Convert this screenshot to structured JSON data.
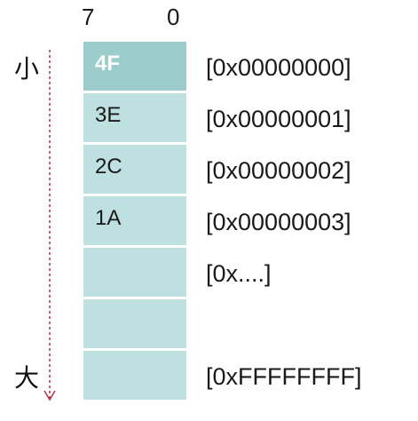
{
  "bits": {
    "high": "7",
    "low": "0"
  },
  "direction": {
    "small": "小",
    "large": "大"
  },
  "colors": {
    "cell": "#bfe0e0",
    "cell_highlight": "#9ccccc",
    "arrow": "#b03040"
  },
  "cells": [
    {
      "value": "4F",
      "address": "[0x00000000]",
      "highlight": true
    },
    {
      "value": "3E",
      "address": "[0x00000001]"
    },
    {
      "value": "2C",
      "address": "[0x00000002]"
    },
    {
      "value": "1A",
      "address": "[0x00000003]"
    },
    {
      "value": "",
      "address": "[0x....]"
    },
    {
      "value": "",
      "address": ""
    },
    {
      "value": "",
      "address": "[0xFFFFFFFF]"
    }
  ]
}
